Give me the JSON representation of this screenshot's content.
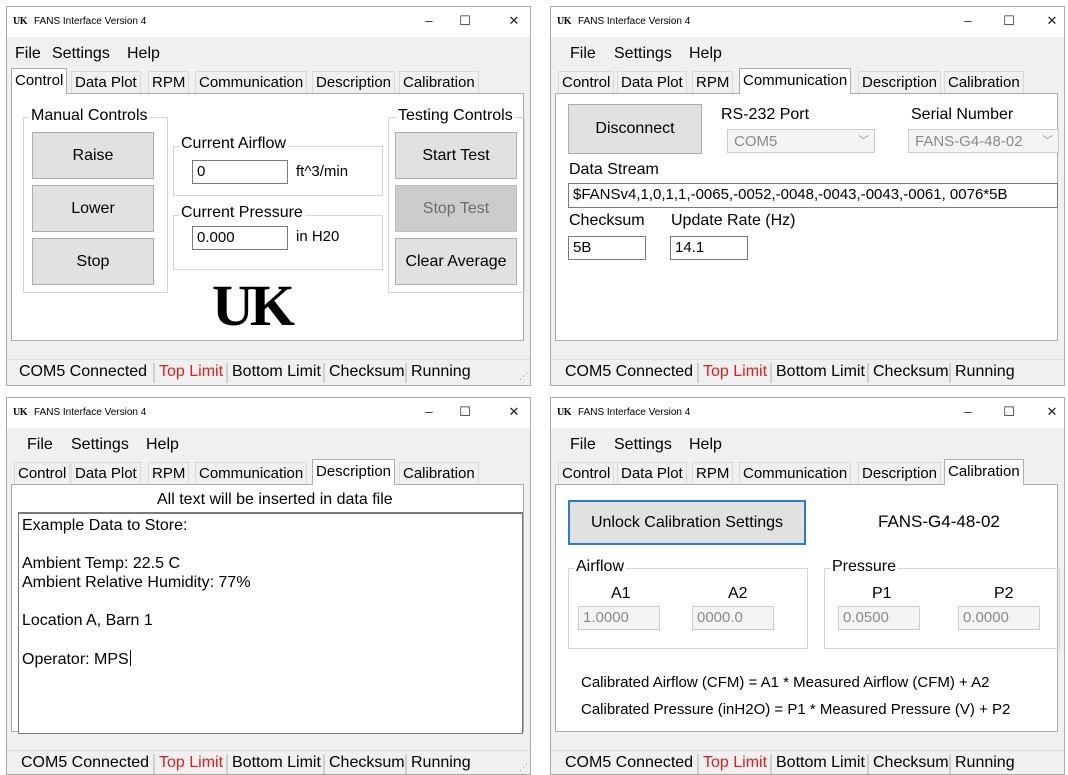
{
  "window": {
    "title": "FANS Interface Version 4",
    "logo": "UK",
    "minimize_icon": "–",
    "maximize_icon": "☐",
    "close_icon": "✕"
  },
  "menu": {
    "file": "File",
    "settings": "Settings",
    "help": "Help"
  },
  "tabs": {
    "control": "Control",
    "data_plot": "Data Plot",
    "rpm": "RPM",
    "communication": "Communication",
    "description": "Description",
    "calibration": "Calibration"
  },
  "status": {
    "connection": "COM5 Connected",
    "top_limit": "Top Limit",
    "bottom_limit": "Bottom Limit",
    "checksum": "Checksum",
    "running": "Running"
  },
  "colors": {
    "status_alert": "#e02020",
    "focus_border": "#2d7ad2"
  },
  "control": {
    "manual_group": "Manual Controls",
    "raise": "Raise",
    "lower": "Lower",
    "stop": "Stop",
    "airflow_label": "Current Airflow",
    "airflow_value": "0",
    "airflow_unit": "ft^3/min",
    "pressure_label": "Current Pressure",
    "pressure_value": "0.000",
    "pressure_unit": "in H20",
    "testing_group": "Testing Controls",
    "start_test": "Start Test",
    "stop_test": "Stop Test",
    "clear_average": "Clear Average",
    "logo": "UK"
  },
  "communication": {
    "disconnect": "Disconnect",
    "port_label": "RS-232 Port",
    "port_value": "COM5",
    "serial_label": "Serial Number",
    "serial_value": "FANS-G4-48-02",
    "stream_label": "Data Stream",
    "stream_value": "$FANSv4,1,0,1,1,-0065,-0052,-0048,-0043,-0043,-0061, 0076*5B",
    "checksum_label": "Checksum",
    "checksum_value": "5B",
    "rate_label": "Update Rate (Hz)",
    "rate_value": "14.1"
  },
  "description": {
    "hint": "All text will be inserted in data file",
    "lines": [
      "Example Data to Store:",
      "Ambient Temp: 22.5 C",
      "Ambient Relative Humidity: 77%",
      "Location A, Barn 1",
      "Operator: MPS"
    ]
  },
  "calibration": {
    "unlock": "Unlock Calibration Settings",
    "serial": "FANS-G4-48-02",
    "airflow_group": "Airflow",
    "a1_label": "A1",
    "a1_value": "1.0000",
    "a2_label": "A2",
    "a2_value": "0000.0",
    "pressure_group": "Pressure",
    "p1_label": "P1",
    "p1_value": "0.0500",
    "p2_label": "P2",
    "p2_value": "0.0000",
    "formula_airflow": "Calibrated Airflow (CFM) = A1 * Measured Airflow (CFM) + A2",
    "formula_pressure": "Calibrated Pressure (inH2O) = P1 * Measured Pressure (V) + P2"
  }
}
